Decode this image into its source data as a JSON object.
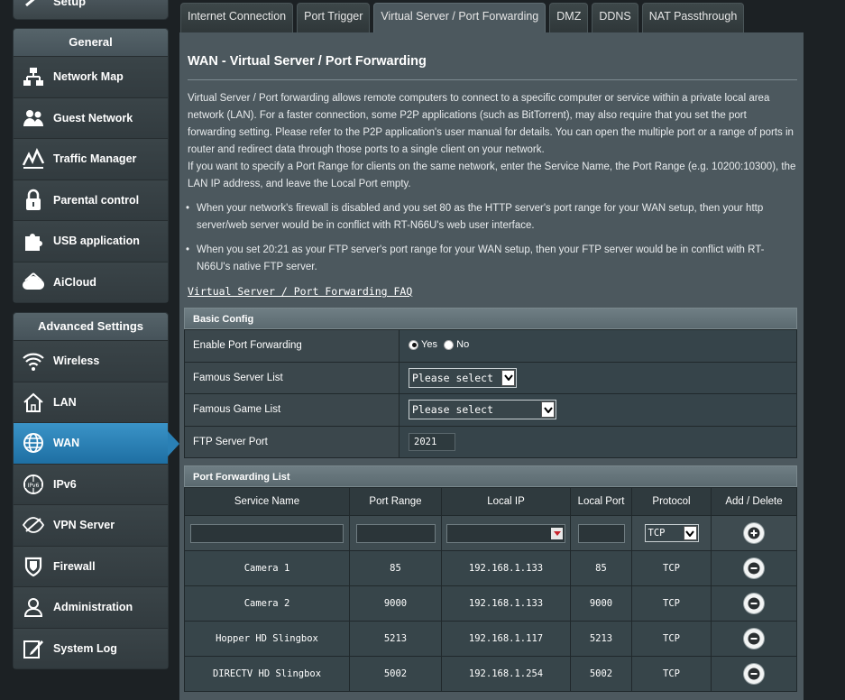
{
  "sidebar": {
    "setup_label": "Setup",
    "general_header": "General",
    "general_items": [
      {
        "label": "Network Map",
        "icon": "network-map-icon"
      },
      {
        "label": "Guest Network",
        "icon": "guest-network-icon"
      },
      {
        "label": "Traffic Manager",
        "icon": "traffic-manager-icon"
      },
      {
        "label": "Parental control",
        "icon": "lock-icon"
      },
      {
        "label": "USB application",
        "icon": "puzzle-icon"
      },
      {
        "label": "AiCloud",
        "icon": "cloud-icon"
      }
    ],
    "advanced_header": "Advanced Settings",
    "advanced_items": [
      {
        "label": "Wireless",
        "icon": "wifi-icon"
      },
      {
        "label": "LAN",
        "icon": "home-icon"
      },
      {
        "label": "WAN",
        "icon": "globe-icon",
        "active": true
      },
      {
        "label": "IPv6",
        "icon": "ipv6-globe-icon"
      },
      {
        "label": "VPN Server",
        "icon": "vpn-icon"
      },
      {
        "label": "Firewall",
        "icon": "shield-icon"
      },
      {
        "label": "Administration",
        "icon": "user-icon"
      },
      {
        "label": "System Log",
        "icon": "edit-log-icon"
      }
    ]
  },
  "tabs": [
    {
      "label": "Internet Connection"
    },
    {
      "label": "Port Trigger"
    },
    {
      "label": "Virtual Server / Port Forwarding",
      "active": true
    },
    {
      "label": "DMZ"
    },
    {
      "label": "DDNS"
    },
    {
      "label": "NAT Passthrough"
    }
  ],
  "page": {
    "title": "WAN - Virtual Server / Port Forwarding",
    "description_1": "Virtual Server / Port forwarding allows remote computers to connect to a specific computer or service within a private local area network (LAN). For a faster connection, some P2P applications (such as BitTorrent), may also require that you set the port forwarding setting. Please refer to the P2P application's user manual for details. You can open the multiple port or a range of ports in router and redirect data through those ports to a single client on your network.",
    "description_2": "If you want to specify a Port Range for clients on the same network, enter the Service Name, the Port Range (e.g. 10200:10300), the LAN IP address, and leave the Local Port empty.",
    "bullet_1": "When your network's firewall is disabled and you set 80 as the HTTP server's port range for your WAN setup, then your http server/web server would be in conflict with RT-N66U's web user interface.",
    "bullet_2": "When you set 20:21 as your FTP server's port range for your WAN setup, then your FTP server would be in conflict with RT-N66U's native FTP server.",
    "faq_link": "Virtual Server / Port Forwarding FAQ"
  },
  "basic_config": {
    "header": "Basic Config",
    "enable_label": "Enable Port Forwarding",
    "yes_label": "Yes",
    "no_label": "No",
    "enabled": "Yes",
    "famous_server_label": "Famous Server List",
    "famous_server_value": "Please select",
    "famous_game_label": "Famous Game List",
    "famous_game_value": "Please select",
    "ftp_port_label": "FTP Server Port",
    "ftp_port_value": "2021"
  },
  "port_forwarding": {
    "header": "Port Forwarding List",
    "columns": [
      "Service Name",
      "Port Range",
      "Local IP",
      "Local Port",
      "Protocol",
      "Add / Delete"
    ],
    "new_protocol": "TCP",
    "rows": [
      {
        "service": "Camera 1",
        "port_range": "85",
        "local_ip": "192.168.1.133",
        "local_port": "85",
        "protocol": "TCP"
      },
      {
        "service": "Camera 2",
        "port_range": "9000",
        "local_ip": "192.168.1.133",
        "local_port": "9000",
        "protocol": "TCP"
      },
      {
        "service": "Hopper HD Slingbox",
        "port_range": "5213",
        "local_ip": "192.168.1.117",
        "local_port": "5213",
        "protocol": "TCP"
      },
      {
        "service": "DIRECTV HD Slingbox",
        "port_range": "5002",
        "local_ip": "192.168.1.254",
        "local_port": "5002",
        "protocol": "TCP"
      }
    ]
  },
  "colors": {
    "active_nav": "#2a80b5",
    "panel_bg": "#4c585e",
    "page_bg": "#1c2124"
  }
}
